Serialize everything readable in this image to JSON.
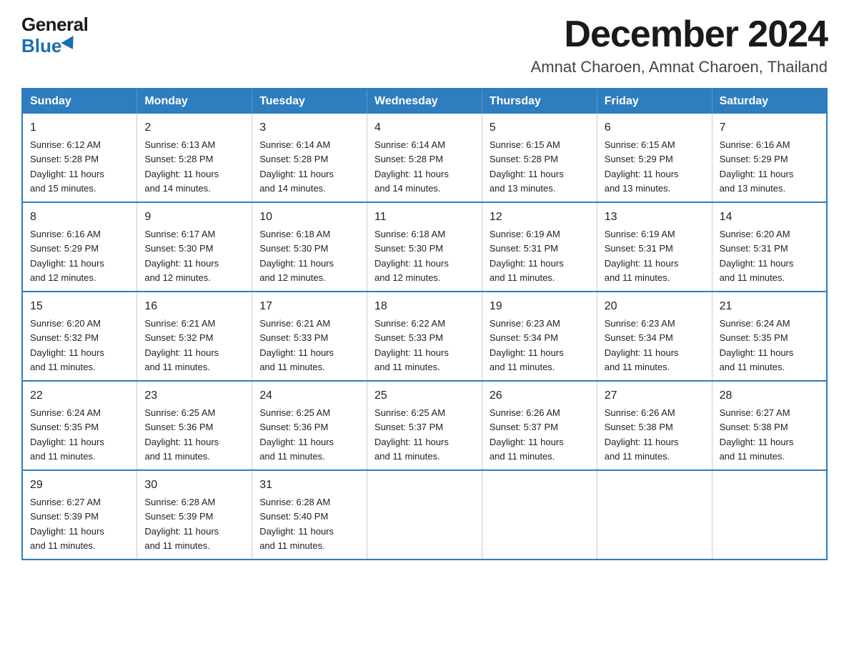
{
  "logo": {
    "general": "General",
    "blue": "Blue"
  },
  "title": "December 2024",
  "subtitle": "Amnat Charoen, Amnat Charoen, Thailand",
  "calendar": {
    "headers": [
      "Sunday",
      "Monday",
      "Tuesday",
      "Wednesday",
      "Thursday",
      "Friday",
      "Saturday"
    ],
    "weeks": [
      [
        {
          "day": "1",
          "sunrise": "6:12 AM",
          "sunset": "5:28 PM",
          "daylight": "11 hours and 15 minutes."
        },
        {
          "day": "2",
          "sunrise": "6:13 AM",
          "sunset": "5:28 PM",
          "daylight": "11 hours and 14 minutes."
        },
        {
          "day": "3",
          "sunrise": "6:14 AM",
          "sunset": "5:28 PM",
          "daylight": "11 hours and 14 minutes."
        },
        {
          "day": "4",
          "sunrise": "6:14 AM",
          "sunset": "5:28 PM",
          "daylight": "11 hours and 14 minutes."
        },
        {
          "day": "5",
          "sunrise": "6:15 AM",
          "sunset": "5:28 PM",
          "daylight": "11 hours and 13 minutes."
        },
        {
          "day": "6",
          "sunrise": "6:15 AM",
          "sunset": "5:29 PM",
          "daylight": "11 hours and 13 minutes."
        },
        {
          "day": "7",
          "sunrise": "6:16 AM",
          "sunset": "5:29 PM",
          "daylight": "11 hours and 13 minutes."
        }
      ],
      [
        {
          "day": "8",
          "sunrise": "6:16 AM",
          "sunset": "5:29 PM",
          "daylight": "11 hours and 12 minutes."
        },
        {
          "day": "9",
          "sunrise": "6:17 AM",
          "sunset": "5:30 PM",
          "daylight": "11 hours and 12 minutes."
        },
        {
          "day": "10",
          "sunrise": "6:18 AM",
          "sunset": "5:30 PM",
          "daylight": "11 hours and 12 minutes."
        },
        {
          "day": "11",
          "sunrise": "6:18 AM",
          "sunset": "5:30 PM",
          "daylight": "11 hours and 12 minutes."
        },
        {
          "day": "12",
          "sunrise": "6:19 AM",
          "sunset": "5:31 PM",
          "daylight": "11 hours and 11 minutes."
        },
        {
          "day": "13",
          "sunrise": "6:19 AM",
          "sunset": "5:31 PM",
          "daylight": "11 hours and 11 minutes."
        },
        {
          "day": "14",
          "sunrise": "6:20 AM",
          "sunset": "5:31 PM",
          "daylight": "11 hours and 11 minutes."
        }
      ],
      [
        {
          "day": "15",
          "sunrise": "6:20 AM",
          "sunset": "5:32 PM",
          "daylight": "11 hours and 11 minutes."
        },
        {
          "day": "16",
          "sunrise": "6:21 AM",
          "sunset": "5:32 PM",
          "daylight": "11 hours and 11 minutes."
        },
        {
          "day": "17",
          "sunrise": "6:21 AM",
          "sunset": "5:33 PM",
          "daylight": "11 hours and 11 minutes."
        },
        {
          "day": "18",
          "sunrise": "6:22 AM",
          "sunset": "5:33 PM",
          "daylight": "11 hours and 11 minutes."
        },
        {
          "day": "19",
          "sunrise": "6:23 AM",
          "sunset": "5:34 PM",
          "daylight": "11 hours and 11 minutes."
        },
        {
          "day": "20",
          "sunrise": "6:23 AM",
          "sunset": "5:34 PM",
          "daylight": "11 hours and 11 minutes."
        },
        {
          "day": "21",
          "sunrise": "6:24 AM",
          "sunset": "5:35 PM",
          "daylight": "11 hours and 11 minutes."
        }
      ],
      [
        {
          "day": "22",
          "sunrise": "6:24 AM",
          "sunset": "5:35 PM",
          "daylight": "11 hours and 11 minutes."
        },
        {
          "day": "23",
          "sunrise": "6:25 AM",
          "sunset": "5:36 PM",
          "daylight": "11 hours and 11 minutes."
        },
        {
          "day": "24",
          "sunrise": "6:25 AM",
          "sunset": "5:36 PM",
          "daylight": "11 hours and 11 minutes."
        },
        {
          "day": "25",
          "sunrise": "6:25 AM",
          "sunset": "5:37 PM",
          "daylight": "11 hours and 11 minutes."
        },
        {
          "day": "26",
          "sunrise": "6:26 AM",
          "sunset": "5:37 PM",
          "daylight": "11 hours and 11 minutes."
        },
        {
          "day": "27",
          "sunrise": "6:26 AM",
          "sunset": "5:38 PM",
          "daylight": "11 hours and 11 minutes."
        },
        {
          "day": "28",
          "sunrise": "6:27 AM",
          "sunset": "5:38 PM",
          "daylight": "11 hours and 11 minutes."
        }
      ],
      [
        {
          "day": "29",
          "sunrise": "6:27 AM",
          "sunset": "5:39 PM",
          "daylight": "11 hours and 11 minutes."
        },
        {
          "day": "30",
          "sunrise": "6:28 AM",
          "sunset": "5:39 PM",
          "daylight": "11 hours and 11 minutes."
        },
        {
          "day": "31",
          "sunrise": "6:28 AM",
          "sunset": "5:40 PM",
          "daylight": "11 hours and 11 minutes."
        },
        null,
        null,
        null,
        null
      ]
    ]
  },
  "labels": {
    "sunrise": "Sunrise:",
    "sunset": "Sunset:",
    "daylight": "Daylight:"
  }
}
